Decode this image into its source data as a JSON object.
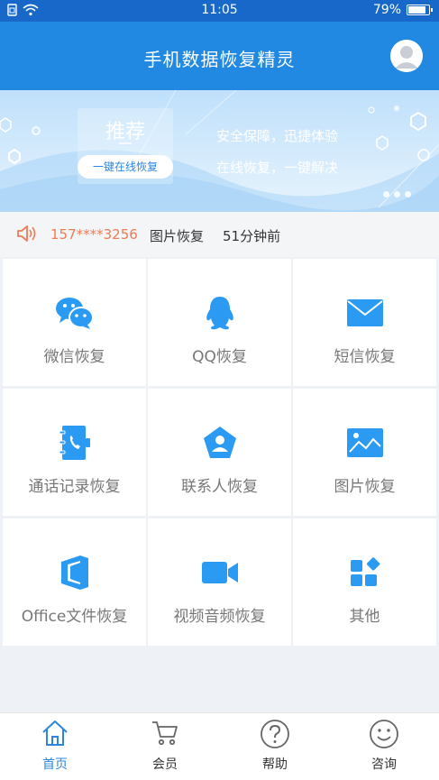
{
  "status_bar": {
    "time": "11:05",
    "battery": "79%",
    "battery_level": 0.79
  },
  "header": {
    "title": "手机数据恢复精灵"
  },
  "banner": {
    "recommend_title": "推荐",
    "recommend_button": "一键在线恢复",
    "slogan_1": "安全保障，迅捷体验",
    "slogan_2": "在线恢复，一键解决"
  },
  "notice": {
    "phone": "157****3256",
    "type": "图片恢复",
    "time_ago": "51分钟前"
  },
  "grid": {
    "items": [
      {
        "label": "微信恢复",
        "icon": "wechat-icon"
      },
      {
        "label": "QQ恢复",
        "icon": "qq-icon"
      },
      {
        "label": "短信恢复",
        "icon": "sms-icon"
      },
      {
        "label": "通话记录恢复",
        "icon": "call-log-icon"
      },
      {
        "label": "联系人恢复",
        "icon": "contacts-icon"
      },
      {
        "label": "图片恢复",
        "icon": "image-icon"
      },
      {
        "label": "Office文件恢复",
        "icon": "office-icon"
      },
      {
        "label": "视频音频恢复",
        "icon": "video-icon"
      },
      {
        "label": "其他",
        "icon": "apps-icon"
      }
    ]
  },
  "tabbar": {
    "items": [
      {
        "label": "首页",
        "icon": "home-icon"
      },
      {
        "label": "会员",
        "icon": "cart-icon"
      },
      {
        "label": "帮助",
        "icon": "help-icon"
      },
      {
        "label": "咨询",
        "icon": "smile-icon"
      }
    ]
  },
  "colors": {
    "primary": "#2289e2",
    "status_bar": "#1768c8",
    "highlight": "#ef7a55",
    "icon_blue": "#2b9af3"
  }
}
